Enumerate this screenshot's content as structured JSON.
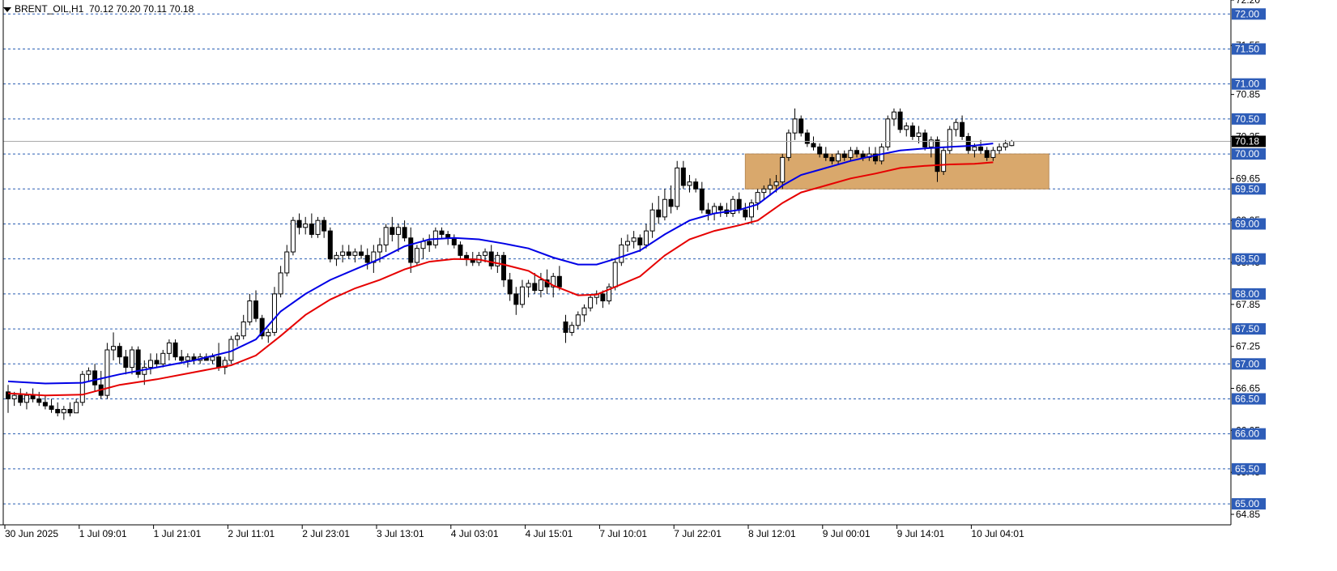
{
  "header": {
    "symbol": "BRENT_OIL,H1",
    "ohlc": "70.12 70.20 70.11 70.18"
  },
  "colors": {
    "background": "#ffffff",
    "grid": "#2b5fb3",
    "candle": "#000000",
    "ma_fast": "#0000e6",
    "ma_slow": "#e60000",
    "zone_fill": "#d9a86c",
    "axis": "#000000",
    "label_bg": "#2e5db8",
    "current_bg": "#000000"
  },
  "chart_data": {
    "type": "candlestick",
    "symbol": "BRENT_OIL,H1",
    "ylim": [
      64.7,
      72.2
    ],
    "xlim": [
      0,
      165
    ],
    "x_tick_labels": [
      {
        "x": 0,
        "label": "30 Jun 2025"
      },
      {
        "x": 12,
        "label": "1 Jul 09:01"
      },
      {
        "x": 24,
        "label": "1 Jul 21:01"
      },
      {
        "x": 36,
        "label": "2 Jul 11:01"
      },
      {
        "x": 48,
        "label": "2 Jul 23:01"
      },
      {
        "x": 60,
        "label": "3 Jul 13:01"
      },
      {
        "x": 72,
        "label": "4 Jul 03:01"
      },
      {
        "x": 84,
        "label": "4 Jul 15:01"
      },
      {
        "x": 96,
        "label": "7 Jul 10:01"
      },
      {
        "x": 108,
        "label": "7 Jul 22:01"
      },
      {
        "x": 120,
        "label": "8 Jul 12:01"
      },
      {
        "x": 132,
        "label": "9 Jul 00:01"
      },
      {
        "x": 144,
        "label": "9 Jul 14:01"
      },
      {
        "x": 156,
        "label": "10 Jul 04:01"
      }
    ],
    "grid_levels": [
      72.0,
      71.5,
      71.0,
      70.5,
      70.0,
      69.5,
      69.0,
      68.5,
      68.0,
      67.5,
      67.0,
      66.5,
      66.0,
      65.5,
      65.0
    ],
    "y_tick_labels": [
      {
        "value": 72.2,
        "label": "72.20"
      },
      {
        "value": 71.55,
        "label": "71.55"
      },
      {
        "value": 70.85,
        "label": "70.85"
      },
      {
        "value": 70.25,
        "label": "70.25"
      },
      {
        "value": 69.65,
        "label": "69.65"
      },
      {
        "value": 69.05,
        "label": "69.05"
      },
      {
        "value": 68.45,
        "label": "68.45"
      },
      {
        "value": 67.85,
        "label": "67.85"
      },
      {
        "value": 67.25,
        "label": "67.25"
      },
      {
        "value": 66.65,
        "label": "66.65"
      },
      {
        "value": 66.05,
        "label": "66.05"
      },
      {
        "value": 65.45,
        "label": "65.45"
      },
      {
        "value": 64.85,
        "label": "64.85"
      }
    ],
    "current_price": {
      "value": 70.18,
      "label": "70.18"
    },
    "zone": {
      "x_start": 119,
      "x_end": 168,
      "y_low": 69.5,
      "y_high": 70.0
    },
    "candles": [
      [
        66.6,
        66.7,
        66.3,
        66.5
      ],
      [
        66.5,
        66.6,
        66.4,
        66.55
      ],
      [
        66.55,
        66.65,
        66.4,
        66.45
      ],
      [
        66.45,
        66.6,
        66.35,
        66.55
      ],
      [
        66.55,
        66.65,
        66.45,
        66.5
      ],
      [
        66.5,
        66.6,
        66.4,
        66.45
      ],
      [
        66.45,
        66.55,
        66.35,
        66.4
      ],
      [
        66.4,
        66.5,
        66.3,
        66.35
      ],
      [
        66.35,
        66.45,
        66.25,
        66.3
      ],
      [
        66.3,
        66.4,
        66.2,
        66.35
      ],
      [
        66.35,
        66.45,
        66.25,
        66.3
      ],
      [
        66.3,
        66.5,
        66.3,
        66.45
      ],
      [
        66.45,
        66.9,
        66.4,
        66.85
      ],
      [
        66.85,
        66.95,
        66.75,
        66.9
      ],
      [
        66.9,
        67.0,
        66.6,
        66.7
      ],
      [
        66.7,
        66.9,
        66.5,
        66.55
      ],
      [
        66.55,
        67.3,
        66.5,
        67.2
      ],
      [
        67.2,
        67.45,
        67.05,
        67.25
      ],
      [
        67.25,
        67.3,
        67.0,
        67.1
      ],
      [
        67.1,
        67.2,
        66.85,
        66.95
      ],
      [
        66.95,
        67.25,
        66.85,
        67.2
      ],
      [
        67.2,
        67.25,
        66.8,
        66.85
      ],
      [
        66.85,
        67.05,
        66.7,
        66.95
      ],
      [
        66.95,
        67.15,
        66.85,
        67.05
      ],
      [
        67.05,
        67.15,
        66.95,
        67.0
      ],
      [
        67.0,
        67.2,
        66.95,
        67.15
      ],
      [
        67.15,
        67.35,
        67.05,
        67.3
      ],
      [
        67.3,
        67.35,
        67.05,
        67.1
      ],
      [
        67.1,
        67.2,
        67.0,
        67.05
      ],
      [
        67.05,
        67.15,
        66.95,
        67.1
      ],
      [
        67.1,
        67.15,
        67.0,
        67.05
      ],
      [
        67.05,
        67.15,
        67.0,
        67.1
      ],
      [
        67.1,
        67.15,
        67.05,
        67.05
      ],
      [
        67.05,
        67.15,
        67.0,
        67.1
      ],
      [
        67.1,
        67.3,
        66.9,
        66.95
      ],
      [
        66.95,
        67.1,
        66.85,
        67.05
      ],
      [
        67.05,
        67.4,
        67.0,
        67.35
      ],
      [
        67.35,
        67.45,
        67.25,
        67.4
      ],
      [
        67.4,
        67.7,
        67.35,
        67.6
      ],
      [
        67.6,
        68.0,
        67.55,
        67.9
      ],
      [
        67.9,
        68.05,
        67.6,
        67.65
      ],
      [
        67.65,
        67.7,
        67.35,
        67.4
      ],
      [
        67.4,
        67.5,
        67.3,
        67.45
      ],
      [
        67.45,
        68.1,
        67.4,
        68.0
      ],
      [
        68.0,
        68.4,
        67.95,
        68.3
      ],
      [
        68.3,
        68.7,
        68.25,
        68.6
      ],
      [
        68.6,
        69.1,
        68.55,
        69.05
      ],
      [
        69.05,
        69.15,
        68.85,
        68.95
      ],
      [
        68.95,
        69.1,
        68.85,
        69.0
      ],
      [
        69.0,
        69.15,
        68.8,
        68.85
      ],
      [
        68.85,
        69.1,
        68.8,
        69.05
      ],
      [
        69.05,
        69.1,
        68.8,
        68.9
      ],
      [
        68.9,
        68.95,
        68.45,
        68.5
      ],
      [
        68.5,
        68.6,
        68.4,
        68.55
      ],
      [
        68.55,
        68.7,
        68.45,
        68.6
      ],
      [
        68.6,
        68.7,
        68.5,
        68.55
      ],
      [
        68.55,
        68.65,
        68.45,
        68.6
      ],
      [
        68.6,
        68.7,
        68.5,
        68.55
      ],
      [
        68.55,
        68.65,
        68.35,
        68.45
      ],
      [
        68.45,
        68.7,
        68.3,
        68.6
      ],
      [
        68.6,
        68.8,
        68.45,
        68.7
      ],
      [
        68.7,
        69.0,
        68.6,
        68.95
      ],
      [
        68.95,
        69.1,
        68.75,
        68.85
      ],
      [
        68.85,
        69.0,
        68.6,
        68.95
      ],
      [
        68.95,
        69.05,
        68.75,
        68.8
      ],
      [
        68.8,
        68.95,
        68.3,
        68.45
      ],
      [
        68.45,
        68.7,
        68.4,
        68.65
      ],
      [
        68.65,
        68.8,
        68.5,
        68.75
      ],
      [
        68.75,
        68.85,
        68.6,
        68.7
      ],
      [
        68.7,
        68.95,
        68.65,
        68.9
      ],
      [
        68.9,
        68.95,
        68.8,
        68.85
      ],
      [
        68.85,
        68.9,
        68.7,
        68.8
      ],
      [
        68.8,
        68.85,
        68.65,
        68.7
      ],
      [
        68.7,
        68.75,
        68.5,
        68.55
      ],
      [
        68.55,
        68.6,
        68.4,
        68.5
      ],
      [
        68.5,
        68.6,
        68.4,
        68.45
      ],
      [
        68.45,
        68.6,
        68.4,
        68.55
      ],
      [
        68.55,
        68.65,
        68.45,
        68.6
      ],
      [
        68.6,
        68.7,
        68.35,
        68.4
      ],
      [
        68.4,
        68.6,
        68.3,
        68.55
      ],
      [
        68.55,
        68.6,
        68.1,
        68.2
      ],
      [
        68.2,
        68.3,
        67.9,
        68.0
      ],
      [
        68.0,
        68.1,
        67.7,
        67.85
      ],
      [
        67.85,
        68.2,
        67.8,
        68.1
      ],
      [
        68.1,
        68.2,
        67.95,
        68.15
      ],
      [
        68.15,
        68.3,
        68.0,
        68.05
      ],
      [
        68.05,
        68.3,
        67.95,
        68.2
      ],
      [
        68.2,
        68.35,
        68.0,
        68.1
      ],
      [
        68.1,
        68.3,
        67.95,
        68.25
      ],
      [
        68.25,
        68.4,
        68.05,
        68.1
      ],
      [
        67.6,
        67.7,
        67.3,
        67.45
      ],
      [
        67.45,
        67.6,
        67.4,
        67.55
      ],
      [
        67.55,
        67.75,
        67.5,
        67.7
      ],
      [
        67.7,
        67.85,
        67.6,
        67.8
      ],
      [
        67.8,
        68.0,
        67.75,
        67.95
      ],
      [
        67.95,
        68.05,
        67.85,
        68.0
      ],
      [
        68.0,
        68.05,
        67.8,
        67.9
      ],
      [
        67.9,
        68.15,
        67.85,
        68.1
      ],
      [
        68.1,
        68.5,
        68.05,
        68.45
      ],
      [
        68.45,
        68.8,
        68.4,
        68.7
      ],
      [
        68.7,
        68.85,
        68.6,
        68.75
      ],
      [
        68.75,
        68.9,
        68.65,
        68.8
      ],
      [
        68.8,
        68.85,
        68.6,
        68.7
      ],
      [
        68.7,
        69.0,
        68.65,
        68.9
      ],
      [
        68.9,
        69.3,
        68.8,
        69.2
      ],
      [
        69.2,
        69.4,
        69.0,
        69.1
      ],
      [
        69.1,
        69.5,
        69.05,
        69.35
      ],
      [
        69.35,
        69.55,
        69.15,
        69.25
      ],
      [
        69.25,
        69.9,
        69.2,
        69.8
      ],
      [
        69.8,
        69.9,
        69.5,
        69.55
      ],
      [
        69.55,
        69.7,
        69.45,
        69.6
      ],
      [
        69.6,
        69.65,
        69.45,
        69.5
      ],
      [
        69.5,
        69.6,
        69.15,
        69.2
      ],
      [
        69.2,
        69.3,
        69.05,
        69.15
      ],
      [
        69.15,
        69.3,
        69.05,
        69.25
      ],
      [
        69.25,
        69.3,
        69.1,
        69.2
      ],
      [
        69.2,
        69.3,
        69.1,
        69.15
      ],
      [
        69.15,
        69.4,
        69.1,
        69.35
      ],
      [
        69.35,
        69.45,
        69.15,
        69.2
      ],
      [
        69.2,
        69.3,
        69.05,
        69.1
      ],
      [
        69.1,
        69.35,
        69.0,
        69.3
      ],
      [
        69.3,
        69.5,
        69.2,
        69.45
      ],
      [
        69.45,
        69.55,
        69.35,
        69.5
      ],
      [
        69.5,
        69.65,
        69.4,
        69.55
      ],
      [
        69.55,
        69.7,
        69.45,
        69.6
      ],
      [
        69.6,
        70.0,
        69.5,
        69.95
      ],
      [
        69.95,
        70.35,
        69.9,
        70.3
      ],
      [
        70.3,
        70.65,
        70.2,
        70.5
      ],
      [
        70.5,
        70.55,
        70.25,
        70.3
      ],
      [
        70.3,
        70.35,
        70.1,
        70.15
      ],
      [
        70.15,
        70.25,
        70.05,
        70.1
      ],
      [
        70.1,
        70.15,
        69.95,
        70.0
      ],
      [
        70.0,
        70.1,
        69.9,
        69.95
      ],
      [
        69.95,
        70.0,
        69.85,
        69.9
      ],
      [
        69.9,
        70.05,
        69.85,
        70.0
      ],
      [
        70.0,
        70.05,
        69.9,
        69.95
      ],
      [
        69.95,
        70.1,
        69.9,
        70.05
      ],
      [
        70.05,
        70.1,
        69.95,
        70.0
      ],
      [
        70.0,
        70.05,
        69.9,
        69.95
      ],
      [
        69.95,
        70.1,
        69.9,
        70.0
      ],
      [
        70.0,
        70.1,
        69.85,
        69.9
      ],
      [
        69.9,
        70.15,
        69.85,
        70.1
      ],
      [
        70.1,
        70.55,
        70.05,
        70.5
      ],
      [
        70.5,
        70.65,
        70.4,
        70.6
      ],
      [
        70.6,
        70.65,
        70.3,
        70.35
      ],
      [
        70.35,
        70.45,
        70.25,
        70.4
      ],
      [
        70.4,
        70.45,
        70.2,
        70.25
      ],
      [
        70.25,
        70.4,
        70.15,
        70.3
      ],
      [
        70.3,
        70.35,
        70.05,
        70.1
      ],
      [
        70.1,
        70.25,
        69.95,
        70.2
      ],
      [
        70.2,
        70.25,
        69.6,
        69.75
      ],
      [
        69.75,
        70.1,
        69.7,
        70.05
      ],
      [
        70.05,
        70.4,
        70.0,
        70.35
      ],
      [
        70.35,
        70.5,
        70.25,
        70.45
      ],
      [
        70.45,
        70.55,
        70.2,
        70.25
      ],
      [
        70.25,
        70.3,
        70.0,
        70.05
      ],
      [
        70.05,
        70.15,
        69.95,
        70.1
      ],
      [
        70.1,
        70.2,
        70.0,
        70.05
      ],
      [
        70.05,
        70.1,
        69.9,
        69.95
      ],
      [
        69.95,
        70.1,
        69.9,
        70.05
      ],
      [
        70.05,
        70.15,
        70.0,
        70.1
      ],
      [
        70.1,
        70.2,
        70.05,
        70.15
      ],
      [
        70.12,
        70.2,
        70.11,
        70.18
      ]
    ],
    "ma_fast": [
      [
        0,
        66.75
      ],
      [
        6,
        66.72
      ],
      [
        12,
        66.73
      ],
      [
        18,
        66.85
      ],
      [
        24,
        66.95
      ],
      [
        30,
        67.05
      ],
      [
        36,
        67.18
      ],
      [
        40,
        67.35
      ],
      [
        44,
        67.75
      ],
      [
        48,
        68.0
      ],
      [
        52,
        68.2
      ],
      [
        56,
        68.35
      ],
      [
        60,
        68.5
      ],
      [
        64,
        68.68
      ],
      [
        68,
        68.78
      ],
      [
        72,
        68.8
      ],
      [
        76,
        68.78
      ],
      [
        80,
        68.72
      ],
      [
        84,
        68.65
      ],
      [
        88,
        68.52
      ],
      [
        92,
        68.42
      ],
      [
        95,
        68.42
      ],
      [
        98,
        68.5
      ],
      [
        102,
        68.62
      ],
      [
        106,
        68.85
      ],
      [
        110,
        69.05
      ],
      [
        114,
        69.15
      ],
      [
        118,
        69.2
      ],
      [
        121,
        69.28
      ],
      [
        125,
        69.55
      ],
      [
        128,
        69.7
      ],
      [
        132,
        69.8
      ],
      [
        136,
        69.9
      ],
      [
        140,
        69.98
      ],
      [
        144,
        70.05
      ],
      [
        148,
        70.08
      ],
      [
        152,
        70.1
      ],
      [
        156,
        70.12
      ],
      [
        159,
        70.15
      ]
    ],
    "ma_slow": [
      [
        0,
        66.58
      ],
      [
        6,
        66.55
      ],
      [
        12,
        66.56
      ],
      [
        18,
        66.7
      ],
      [
        24,
        66.78
      ],
      [
        30,
        66.88
      ],
      [
        36,
        66.98
      ],
      [
        40,
        67.12
      ],
      [
        44,
        67.4
      ],
      [
        48,
        67.7
      ],
      [
        52,
        67.92
      ],
      [
        56,
        68.08
      ],
      [
        60,
        68.2
      ],
      [
        64,
        68.35
      ],
      [
        68,
        68.46
      ],
      [
        72,
        68.5
      ],
      [
        76,
        68.49
      ],
      [
        80,
        68.42
      ],
      [
        84,
        68.33
      ],
      [
        88,
        68.12
      ],
      [
        92,
        67.98
      ],
      [
        95,
        67.99
      ],
      [
        98,
        68.1
      ],
      [
        102,
        68.25
      ],
      [
        106,
        68.55
      ],
      [
        110,
        68.78
      ],
      [
        114,
        68.9
      ],
      [
        118,
        68.98
      ],
      [
        121,
        69.05
      ],
      [
        125,
        69.3
      ],
      [
        128,
        69.45
      ],
      [
        132,
        69.55
      ],
      [
        136,
        69.65
      ],
      [
        140,
        69.72
      ],
      [
        144,
        69.8
      ],
      [
        148,
        69.83
      ],
      [
        152,
        69.85
      ],
      [
        156,
        69.86
      ],
      [
        159,
        69.88
      ]
    ]
  }
}
